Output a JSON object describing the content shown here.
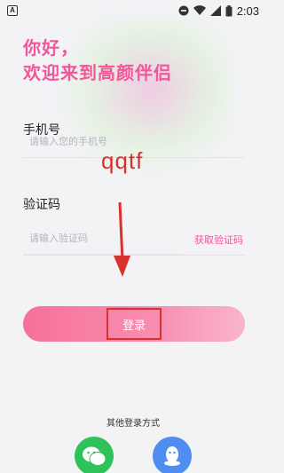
{
  "status_bar": {
    "left_icon": "A",
    "time": "2:03",
    "icons": [
      "do-not-disturb-icon",
      "wifi-icon",
      "signal-icon",
      "battery-icon"
    ]
  },
  "greeting": {
    "line1": "你好，",
    "line2": "欢迎来到高颜伴侣"
  },
  "phone": {
    "label": "手机号",
    "placeholder": "请输入您的手机号"
  },
  "code": {
    "label": "验证码",
    "placeholder": "请输入验证码",
    "get_code": "获取验证码"
  },
  "annotation": {
    "text": "qqtf"
  },
  "login": {
    "label": "登录"
  },
  "other_login": {
    "title": "其他登录方式",
    "options": [
      "wechat-icon",
      "qq-icon"
    ]
  },
  "colors": {
    "accent": "#f0579a",
    "annotation_red": "#d8312f",
    "wechat": "#2fc25b",
    "qq": "#4f8df0"
  }
}
